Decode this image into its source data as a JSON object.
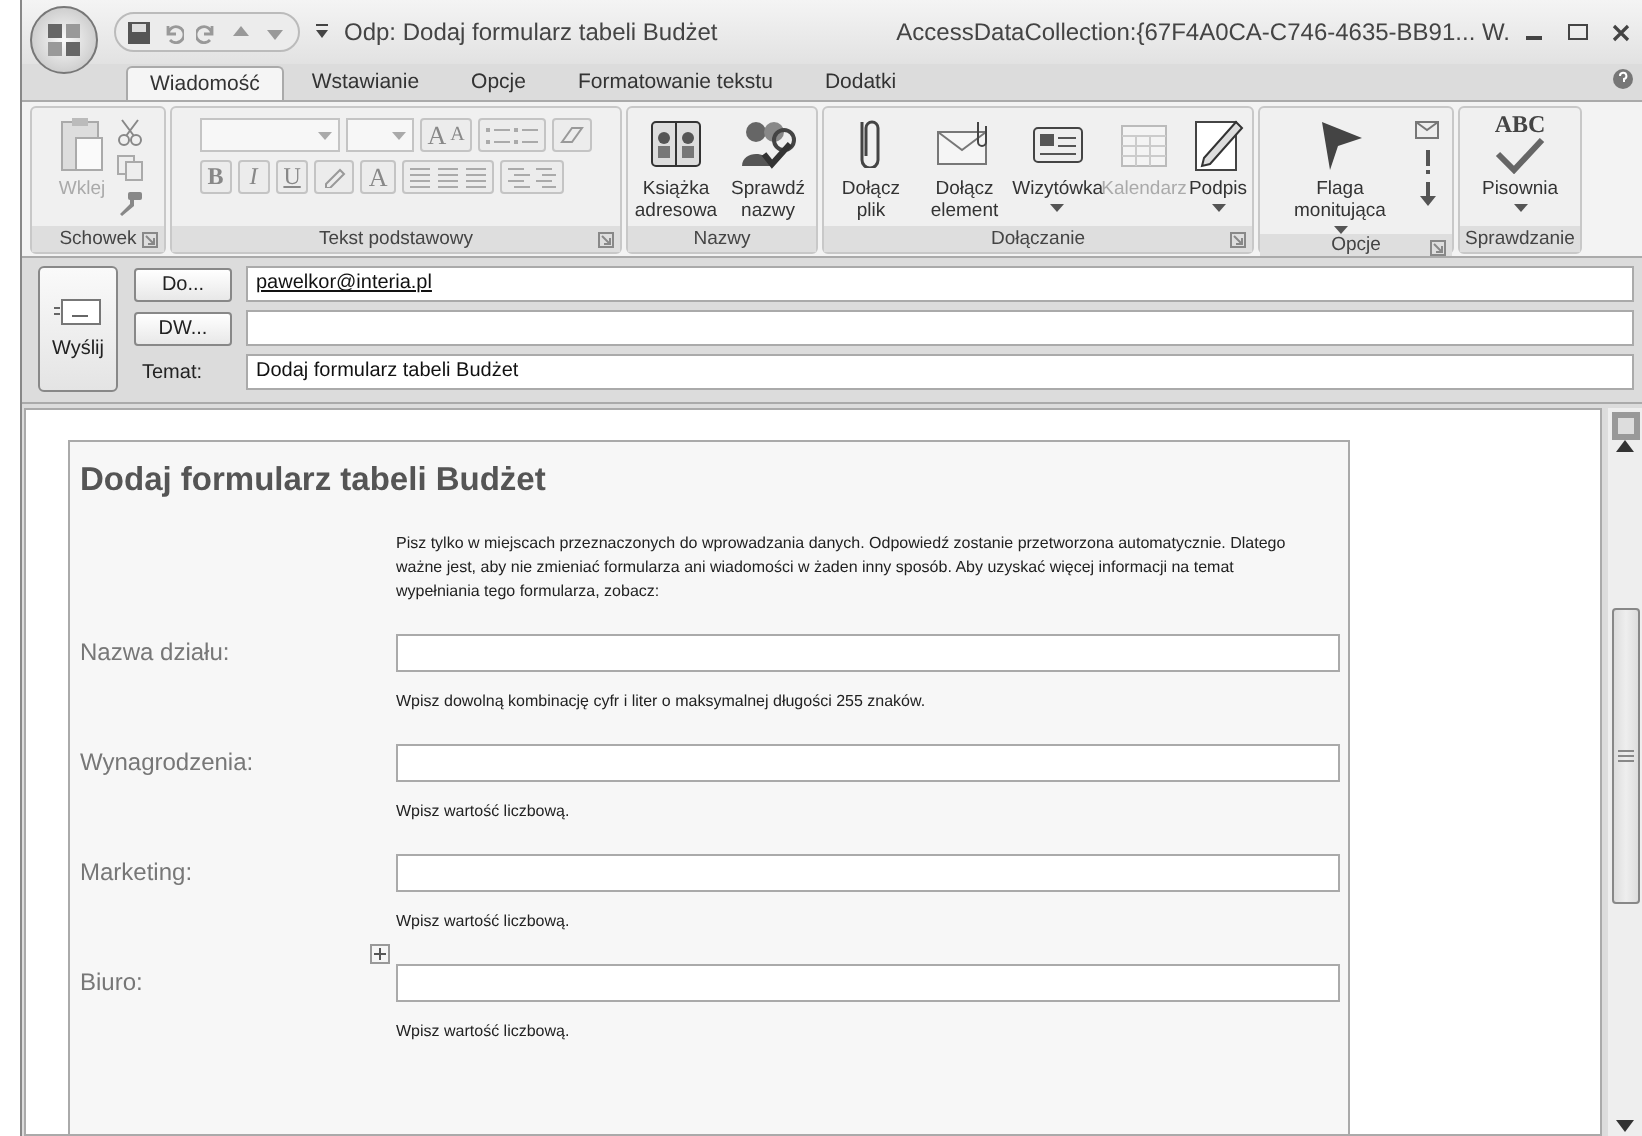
{
  "window": {
    "title": "Odp: Dodaj formularz tabeli Budżet",
    "document": "AccessDataCollection:{67F4A0CA-C746-4635-BB91... W."
  },
  "tabs": [
    {
      "label": "Wiadomość",
      "selected": true
    },
    {
      "label": "Wstawianie",
      "selected": false
    },
    {
      "label": "Opcje",
      "selected": false
    },
    {
      "label": "Formatowanie tekstu",
      "selected": false
    },
    {
      "label": "Dodatki",
      "selected": false
    }
  ],
  "ribbon": {
    "clipboard": {
      "label": "Schowek",
      "paste": {
        "label": "Wklej",
        "disabled": true
      }
    },
    "basic_text": {
      "label": "Tekst podstawowy",
      "grow": "A",
      "shrink": "A",
      "bold": "B",
      "italic": "I",
      "underline": "U",
      "font_color": "A"
    },
    "names": {
      "label": "Nazwy",
      "buttons": [
        {
          "label": "Książka adresowa",
          "disabled": false
        },
        {
          "label": "Sprawdź nazwy",
          "disabled": false
        }
      ]
    },
    "include": {
      "label": "Dołączanie",
      "buttons": [
        {
          "label": "Dołącz plik",
          "disabled": false,
          "menu": false
        },
        {
          "label": "Dołącz element",
          "disabled": false,
          "menu": false
        },
        {
          "label": "Wizytówka",
          "disabled": false,
          "menu": true
        },
        {
          "label": "Kalendarz",
          "disabled": true,
          "menu": false
        },
        {
          "label": "Podpis",
          "disabled": false,
          "menu": true
        }
      ]
    },
    "options": {
      "label": "Opcje",
      "flag": {
        "label": "Flaga monitująca",
        "menu": true
      }
    },
    "proofing": {
      "label": "Sprawdzanie",
      "glyph": "ABC",
      "button": {
        "label": "Pisownia",
        "menu": true
      }
    }
  },
  "header": {
    "send": "Wyślij",
    "to_button": "Do...",
    "to_value": "pawelkor@interia.pl",
    "cc_button": "DW...",
    "subject_label": "Temat:",
    "subject_value": "Dodaj formularz tabeli Budżet"
  },
  "form": {
    "title": "Dodaj formularz tabeli Budżet",
    "intro": "Pisz tylko w miejscach przeznaczonych do wprowadzania danych. Odpowiedź zostanie przetworzona automatycznie. Dlatego ważne jest, aby nie zmieniać formularza ani wiadomości w żaden inny sposób. Aby uzyskać więcej informacji na temat wypełniania tego formularza, zobacz:",
    "fields": [
      {
        "label": "Nazwa działu:",
        "hint": "Wpisz dowolną kombinację cyfr i liter o maksymalnej długości 255 znaków."
      },
      {
        "label": "Wynagrodzenia:",
        "hint": "Wpisz wartość liczbową."
      },
      {
        "label": "Marketing:",
        "hint": "Wpisz wartość liczbową."
      },
      {
        "label": "Biuro:",
        "hint": "Wpisz wartość liczbową."
      }
    ]
  }
}
